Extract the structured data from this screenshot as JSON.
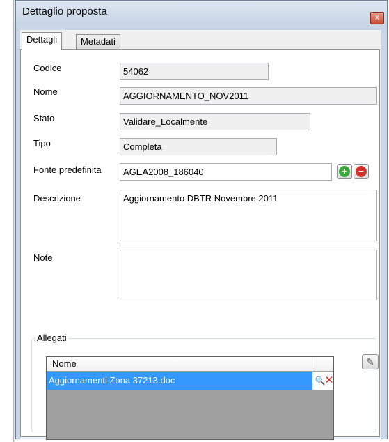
{
  "window": {
    "title": "Dettaglio proposta",
    "close_glyph": "x"
  },
  "tabs": [
    {
      "label": "Dettagli",
      "active": true
    },
    {
      "label": "Metadati",
      "active": false
    }
  ],
  "fields": {
    "codice": {
      "label": "Codice",
      "value": "54062"
    },
    "nome": {
      "label": "Nome",
      "value": "AGGIORNAMENTO_NOV2011"
    },
    "stato": {
      "label": "Stato",
      "value": "Validare_Localmente"
    },
    "tipo": {
      "label": "Tipo",
      "value": "Completa"
    },
    "fonte": {
      "label": "Fonte predefinita",
      "value": "AGEA2008_186040"
    },
    "descrizione": {
      "label": "Descrizione",
      "value": "Aggiornamento DBTR Novembre 2011"
    },
    "note": {
      "label": "Note",
      "value": ""
    }
  },
  "buttons": {
    "add_glyph": "+",
    "remove_glyph": "−",
    "attach_glyph": "✎",
    "view_glyph": "🔍",
    "delete_glyph": "✕"
  },
  "allegati": {
    "title": "Allegati",
    "columns": [
      "Nome"
    ],
    "rows": [
      {
        "nome": "Aggiornamenti Zona 37213.doc"
      }
    ]
  },
  "colors": {
    "selection": "#3399ff",
    "add": "#3aa83a",
    "remove": "#d0342c",
    "delete": "#e0201b"
  }
}
